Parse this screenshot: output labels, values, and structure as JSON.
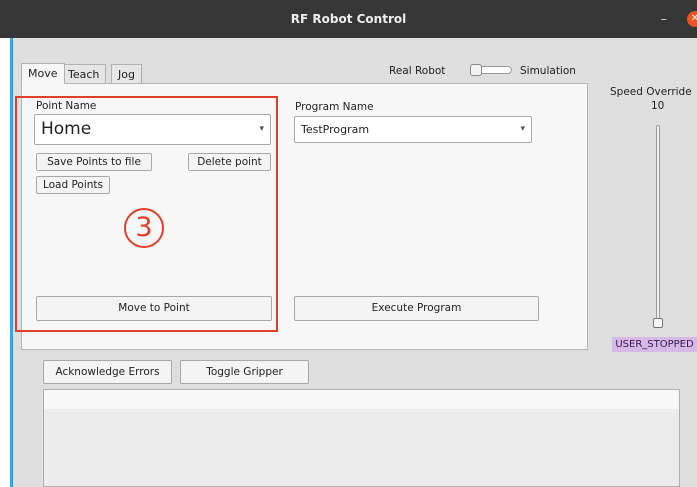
{
  "window": {
    "title": "RF Robot Control",
    "minimize_glyph": "–",
    "close_glyph": "✕"
  },
  "tabs": [
    {
      "label": "Move"
    },
    {
      "label": "Teach"
    },
    {
      "label": "Jog"
    }
  ],
  "mode": {
    "left_label": "Real Robot",
    "right_label": "Simulation"
  },
  "point": {
    "label": "Point Name",
    "value": "Home",
    "save_label": "Save Points to file",
    "delete_label": "Delete point",
    "load_label": "Load Points",
    "move_label": "Move to Point"
  },
  "program": {
    "label": "Program Name",
    "value": "TestProgram",
    "execute_label": "Execute Program"
  },
  "speed": {
    "label": "Speed Override",
    "value": "10",
    "level_fraction": 0.0
  },
  "status": {
    "text": "USER_STOPPED",
    "color": "#d8b8e6"
  },
  "actions": {
    "ack_label": "Acknowledge Errors",
    "gripper_label": "Toggle Gripper"
  },
  "annotation": {
    "number": "3",
    "color": "#e0402a"
  },
  "colors": {
    "accent": "#3aa3dc",
    "titlebar": "#363636",
    "close": "#e95420"
  }
}
